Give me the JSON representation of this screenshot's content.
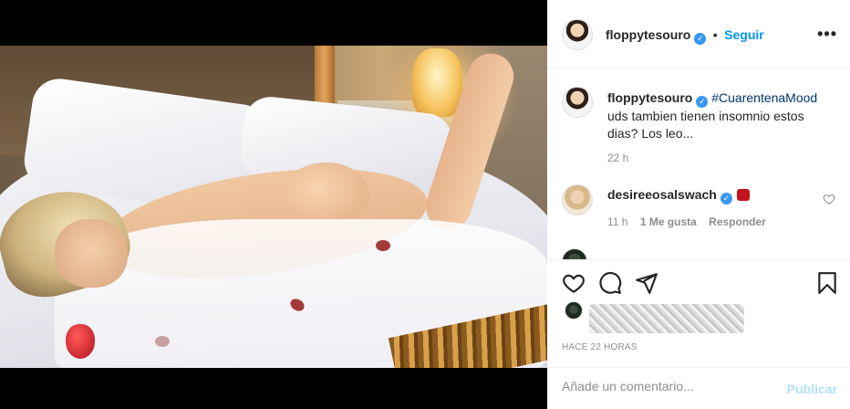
{
  "post": {
    "username": "floppytesouro",
    "follow_label": "Seguir",
    "caption": {
      "hashtag": "#CuarentenaMood",
      "text": "uds tambien tienen insomnio estos dias? Los leo...",
      "time": "22 h"
    },
    "comments": [
      {
        "username": "desireeosalswach",
        "time": "11 h",
        "likes": "1 Me gusta",
        "reply_label": "Responder"
      }
    ],
    "peek_comment_user": "",
    "posted_ago": "HACE 22 HORAS",
    "comment_placeholder": "Añade un comentario...",
    "publish_label": "Publicar"
  },
  "icons": {
    "more": "more-options-icon",
    "verified": "verified-badge-icon",
    "like": "heart-icon",
    "comment": "comment-bubble-icon",
    "share": "paper-plane-icon",
    "save": "bookmark-icon"
  },
  "colors": {
    "accent": "#0095f6",
    "verified": "#3897f0",
    "publish_disabled": "#b2dffc",
    "muted": "#8e8e8e"
  }
}
